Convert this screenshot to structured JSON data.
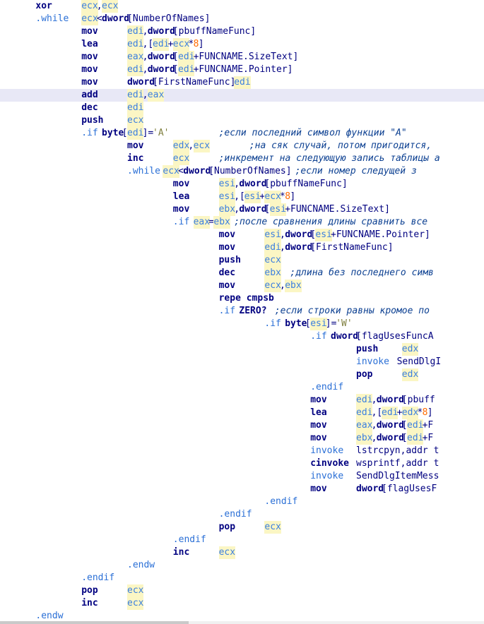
{
  "code_lines": [
    {
      "tokens": [
        {
          "t": "xor",
          "k": "ins",
          "c": 7
        },
        {
          "t": "ecx",
          "k": "reg",
          "c": 16
        },
        {
          "t": ",",
          "k": "pl",
          "c": 19
        },
        {
          "t": "ecx",
          "k": "reg",
          "c": 20
        }
      ]
    },
    {
      "tokens": [
        {
          "t": ".while",
          "k": "dir",
          "c": 7
        },
        {
          "t": "ecx",
          "k": "reg",
          "c": 16
        },
        {
          "t": "<",
          "k": "pl",
          "c": 19
        },
        {
          "t": "dword",
          "k": "ins",
          "c": 20
        },
        {
          "t": "[NumberOfNames]",
          "k": "pl",
          "c": 25
        }
      ]
    },
    {
      "tokens": [
        {
          "t": "mov",
          "k": "ins",
          "c": 16
        },
        {
          "t": "edi",
          "k": "reg",
          "c": 25
        },
        {
          "t": ",",
          "k": "pl",
          "c": 28
        },
        {
          "t": "dword",
          "k": "ins",
          "c": 29
        },
        {
          "t": "[pbuffNameFunc]",
          "k": "pl",
          "c": 34
        }
      ]
    },
    {
      "tokens": [
        {
          "t": "lea",
          "k": "ins",
          "c": 16
        },
        {
          "t": "edi",
          "k": "reg",
          "c": 25
        },
        {
          "t": ",[",
          "k": "pl",
          "c": 28
        },
        {
          "t": "edi",
          "k": "reg",
          "c": 30
        },
        {
          "t": "+",
          "k": "pl",
          "c": 33
        },
        {
          "t": "ecx",
          "k": "reg",
          "c": 34
        },
        {
          "t": "*",
          "k": "pl",
          "c": 37
        },
        {
          "t": "8",
          "k": "num",
          "c": 38
        },
        {
          "t": "]",
          "k": "pl",
          "c": 39
        }
      ]
    },
    {
      "tokens": [
        {
          "t": "mov",
          "k": "ins",
          "c": 16
        },
        {
          "t": "eax",
          "k": "reg",
          "c": 25
        },
        {
          "t": ",",
          "k": "pl",
          "c": 28
        },
        {
          "t": "dword",
          "k": "ins",
          "c": 29
        },
        {
          "t": "[",
          "k": "pl",
          "c": 34
        },
        {
          "t": "edi",
          "k": "reg",
          "c": 35
        },
        {
          "t": "+FUNCNAME.SizeText]",
          "k": "pl",
          "c": 38
        }
      ]
    },
    {
      "tokens": [
        {
          "t": "mov",
          "k": "ins",
          "c": 16
        },
        {
          "t": "edi",
          "k": "reg",
          "c": 25
        },
        {
          "t": ",",
          "k": "pl",
          "c": 28
        },
        {
          "t": "dword",
          "k": "ins",
          "c": 29
        },
        {
          "t": "[",
          "k": "pl",
          "c": 34
        },
        {
          "t": "edi",
          "k": "reg",
          "c": 35
        },
        {
          "t": "+FUNCNAME.Pointer]",
          "k": "pl",
          "c": 38
        }
      ]
    },
    {
      "tokens": [
        {
          "t": "mov",
          "k": "ins",
          "c": 16
        },
        {
          "t": "dword",
          "k": "ins",
          "c": 25
        },
        {
          "t": "[FirstNameFunc],",
          "k": "pl",
          "c": 30
        },
        {
          "t": "edi",
          "k": "reg",
          "c": 46
        }
      ]
    },
    {
      "hl": true,
      "tokens": [
        {
          "t": "add",
          "k": "ins",
          "c": 16
        },
        {
          "t": "edi",
          "k": "reg",
          "c": 25
        },
        {
          "t": ",",
          "k": "pl",
          "c": 28
        },
        {
          "t": "eax",
          "k": "reg",
          "c": 29
        }
      ]
    },
    {
      "tokens": [
        {
          "t": "dec",
          "k": "ins",
          "c": 16
        },
        {
          "t": "edi",
          "k": "reg",
          "c": 25
        }
      ]
    },
    {
      "tokens": [
        {
          "t": "push",
          "k": "ins",
          "c": 16
        },
        {
          "t": "ecx",
          "k": "reg",
          "c": 25
        }
      ]
    },
    {
      "tokens": [
        {
          "t": ".if",
          "k": "dir",
          "c": 16
        },
        {
          "t": "byte",
          "k": "ins",
          "c": 20
        },
        {
          "t": "[",
          "k": "pl",
          "c": 24
        },
        {
          "t": "edi",
          "k": "reg",
          "c": 25
        },
        {
          "t": "]=",
          "k": "pl",
          "c": 28
        },
        {
          "t": "'A'",
          "k": "str",
          "c": 30
        },
        {
          "t": ";если последний символ функции \"А\"",
          "k": "cmt",
          "c": 43
        }
      ]
    },
    {
      "tokens": [
        {
          "t": "mov",
          "k": "ins",
          "c": 25
        },
        {
          "t": "edx",
          "k": "reg",
          "c": 34
        },
        {
          "t": ",",
          "k": "pl",
          "c": 37
        },
        {
          "t": "ecx",
          "k": "reg",
          "c": 38
        },
        {
          "t": ";на сяк случай, потом пригодится,",
          "k": "cmt",
          "c": 49
        }
      ]
    },
    {
      "tokens": [
        {
          "t": "inc",
          "k": "ins",
          "c": 25
        },
        {
          "t": "ecx",
          "k": "reg",
          "c": 34
        },
        {
          "t": ";инкремент на следующую запись таблицы а",
          "k": "cmt",
          "c": 43
        }
      ]
    },
    {
      "tokens": [
        {
          "t": ".while",
          "k": "dir",
          "c": 25
        },
        {
          "t": "ecx",
          "k": "reg",
          "c": 32
        },
        {
          "t": "<",
          "k": "pl",
          "c": 35
        },
        {
          "t": "dword",
          "k": "ins",
          "c": 36
        },
        {
          "t": "[NumberOfNames]",
          "k": "pl",
          "c": 41
        },
        {
          "t": ";если номер следущей з",
          "k": "cmt",
          "c": 58
        }
      ]
    },
    {
      "tokens": [
        {
          "t": "mov",
          "k": "ins",
          "c": 34
        },
        {
          "t": "esi",
          "k": "reg",
          "c": 43
        },
        {
          "t": ",",
          "k": "pl",
          "c": 46
        },
        {
          "t": "dword",
          "k": "ins",
          "c": 47
        },
        {
          "t": "[pbuffNameFunc]",
          "k": "pl",
          "c": 52
        }
      ]
    },
    {
      "tokens": [
        {
          "t": "lea",
          "k": "ins",
          "c": 34
        },
        {
          "t": "esi",
          "k": "reg",
          "c": 43
        },
        {
          "t": ",[",
          "k": "pl",
          "c": 46
        },
        {
          "t": "esi",
          "k": "reg",
          "c": 48
        },
        {
          "t": "+",
          "k": "pl",
          "c": 51
        },
        {
          "t": "ecx",
          "k": "reg",
          "c": 52
        },
        {
          "t": "*",
          "k": "pl",
          "c": 55
        },
        {
          "t": "8",
          "k": "num",
          "c": 56
        },
        {
          "t": "]",
          "k": "pl",
          "c": 57
        }
      ]
    },
    {
      "tokens": [
        {
          "t": "mov",
          "k": "ins",
          "c": 34
        },
        {
          "t": "ebx",
          "k": "reg",
          "c": 43
        },
        {
          "t": ",",
          "k": "pl",
          "c": 46
        },
        {
          "t": "dword",
          "k": "ins",
          "c": 47
        },
        {
          "t": "[",
          "k": "pl",
          "c": 52
        },
        {
          "t": "esi",
          "k": "reg",
          "c": 53
        },
        {
          "t": "+FUNCNAME.SizeText]",
          "k": "pl",
          "c": 56
        }
      ]
    },
    {
      "tokens": [
        {
          "t": ".if",
          "k": "dir",
          "c": 34
        },
        {
          "t": "eax",
          "k": "reg",
          "c": 38
        },
        {
          "t": "=",
          "k": "pl",
          "c": 41
        },
        {
          "t": "ebx",
          "k": "reg",
          "c": 42
        },
        {
          "t": ";после сравнения длины сравнить все",
          "k": "cmt",
          "c": 46
        }
      ]
    },
    {
      "tokens": [
        {
          "t": "mov",
          "k": "ins",
          "c": 43
        },
        {
          "t": "esi",
          "k": "reg",
          "c": 52
        },
        {
          "t": ",",
          "k": "pl",
          "c": 55
        },
        {
          "t": "dword",
          "k": "ins",
          "c": 56
        },
        {
          "t": "[",
          "k": "pl",
          "c": 61
        },
        {
          "t": "esi",
          "k": "reg",
          "c": 62
        },
        {
          "t": "+FUNCNAME.Pointer]",
          "k": "pl",
          "c": 65
        }
      ]
    },
    {
      "tokens": [
        {
          "t": "mov",
          "k": "ins",
          "c": 43
        },
        {
          "t": "edi",
          "k": "reg",
          "c": 52
        },
        {
          "t": ",",
          "k": "pl",
          "c": 55
        },
        {
          "t": "dword",
          "k": "ins",
          "c": 56
        },
        {
          "t": "[FirstNameFunc]",
          "k": "pl",
          "c": 61
        }
      ]
    },
    {
      "tokens": [
        {
          "t": "push",
          "k": "ins",
          "c": 43
        },
        {
          "t": "ecx",
          "k": "reg",
          "c": 52
        }
      ]
    },
    {
      "tokens": [
        {
          "t": "dec",
          "k": "ins",
          "c": 43
        },
        {
          "t": "ebx",
          "k": "reg",
          "c": 52
        },
        {
          "t": ";длина без последнего симв",
          "k": "cmt",
          "c": 57
        }
      ]
    },
    {
      "tokens": [
        {
          "t": "mov",
          "k": "ins",
          "c": 43
        },
        {
          "t": "ecx",
          "k": "reg",
          "c": 52
        },
        {
          "t": ",",
          "k": "pl",
          "c": 55
        },
        {
          "t": "ebx",
          "k": "reg",
          "c": 56
        }
      ]
    },
    {
      "tokens": [
        {
          "t": "repe cmpsb",
          "k": "ins",
          "c": 43
        }
      ]
    },
    {
      "tokens": [
        {
          "t": ".if",
          "k": "dir",
          "c": 43
        },
        {
          "t": "ZERO?",
          "k": "ins",
          "c": 47
        },
        {
          "t": ";если строки равны кромое по",
          "k": "cmt",
          "c": 54
        }
      ]
    },
    {
      "tokens": [
        {
          "t": ".if",
          "k": "dir",
          "c": 52
        },
        {
          "t": "byte",
          "k": "ins",
          "c": 56
        },
        {
          "t": "[",
          "k": "pl",
          "c": 60
        },
        {
          "t": "esi",
          "k": "reg",
          "c": 61
        },
        {
          "t": "]=",
          "k": "pl",
          "c": 64
        },
        {
          "t": "'W'",
          "k": "str",
          "c": 66
        }
      ]
    },
    {
      "tokens": [
        {
          "t": ".if",
          "k": "dir",
          "c": 61
        },
        {
          "t": "dword",
          "k": "ins",
          "c": 65
        },
        {
          "t": "[flagUsesFuncA",
          "k": "pl",
          "c": 70
        }
      ]
    },
    {
      "tokens": [
        {
          "t": "push",
          "k": "ins",
          "c": 70
        },
        {
          "t": "edx",
          "k": "reg",
          "c": 79
        }
      ]
    },
    {
      "tokens": [
        {
          "t": "invoke",
          "k": "dir",
          "c": 70
        },
        {
          "t": "SendDlgI",
          "k": "pl",
          "c": 78
        }
      ]
    },
    {
      "tokens": [
        {
          "t": "pop",
          "k": "ins",
          "c": 70
        },
        {
          "t": "edx",
          "k": "reg",
          "c": 79
        }
      ]
    },
    {
      "tokens": [
        {
          "t": ".endif",
          "k": "dir",
          "c": 61
        }
      ]
    },
    {
      "tokens": [
        {
          "t": "mov",
          "k": "ins",
          "c": 61
        },
        {
          "t": "edi",
          "k": "reg",
          "c": 70
        },
        {
          "t": ",",
          "k": "pl",
          "c": 73
        },
        {
          "t": "dword",
          "k": "ins",
          "c": 74
        },
        {
          "t": "[pbuff",
          "k": "pl",
          "c": 79
        }
      ]
    },
    {
      "tokens": [
        {
          "t": "lea",
          "k": "ins",
          "c": 61
        },
        {
          "t": "edi",
          "k": "reg",
          "c": 70
        },
        {
          "t": ",[",
          "k": "pl",
          "c": 73
        },
        {
          "t": "edi",
          "k": "reg",
          "c": 75
        },
        {
          "t": "+",
          "k": "pl",
          "c": 78
        },
        {
          "t": "edx",
          "k": "reg",
          "c": 79
        },
        {
          "t": "*",
          "k": "pl",
          "c": 82
        },
        {
          "t": "8",
          "k": "num",
          "c": 83
        },
        {
          "t": "]",
          "k": "pl",
          "c": 84
        }
      ]
    },
    {
      "tokens": [
        {
          "t": "mov",
          "k": "ins",
          "c": 61
        },
        {
          "t": "eax",
          "k": "reg",
          "c": 70
        },
        {
          "t": ",",
          "k": "pl",
          "c": 73
        },
        {
          "t": "dword",
          "k": "ins",
          "c": 74
        },
        {
          "t": "[",
          "k": "pl",
          "c": 79
        },
        {
          "t": "edi",
          "k": "reg",
          "c": 80
        },
        {
          "t": "+F",
          "k": "pl",
          "c": 83
        }
      ]
    },
    {
      "tokens": [
        {
          "t": "mov",
          "k": "ins",
          "c": 61
        },
        {
          "t": "ebx",
          "k": "reg",
          "c": 70
        },
        {
          "t": ",",
          "k": "pl",
          "c": 73
        },
        {
          "t": "dword",
          "k": "ins",
          "c": 74
        },
        {
          "t": "[",
          "k": "pl",
          "c": 79
        },
        {
          "t": "edi",
          "k": "reg",
          "c": 80
        },
        {
          "t": "+F",
          "k": "pl",
          "c": 83
        }
      ]
    },
    {
      "tokens": [
        {
          "t": "invoke",
          "k": "dir",
          "c": 61
        },
        {
          "t": "lstrcpyn,addr t",
          "k": "pl",
          "c": 70
        }
      ]
    },
    {
      "tokens": [
        {
          "t": "cinvoke",
          "k": "ins",
          "c": 61
        },
        {
          "t": "wsprintf,addr t",
          "k": "pl",
          "c": 70
        }
      ]
    },
    {
      "tokens": [
        {
          "t": "invoke",
          "k": "dir",
          "c": 61
        },
        {
          "t": "SendDlgItemMess",
          "k": "pl",
          "c": 70
        }
      ]
    },
    {
      "tokens": [
        {
          "t": "mov",
          "k": "ins",
          "c": 61
        },
        {
          "t": "dword",
          "k": "ins",
          "c": 70
        },
        {
          "t": "[flagUsesF",
          "k": "pl",
          "c": 75
        }
      ]
    },
    {
      "tokens": [
        {
          "t": ".endif",
          "k": "dir",
          "c": 52
        }
      ]
    },
    {
      "tokens": [
        {
          "t": ".endif",
          "k": "dir",
          "c": 43
        }
      ]
    },
    {
      "tokens": [
        {
          "t": "pop",
          "k": "ins",
          "c": 43
        },
        {
          "t": "ecx",
          "k": "reg",
          "c": 52
        }
      ]
    },
    {
      "tokens": [
        {
          "t": ".endif",
          "k": "dir",
          "c": 34
        }
      ]
    },
    {
      "tokens": [
        {
          "t": "inc",
          "k": "ins",
          "c": 34
        },
        {
          "t": "ecx",
          "k": "reg",
          "c": 43
        }
      ]
    },
    {
      "tokens": [
        {
          "t": ".endw",
          "k": "dir",
          "c": 25
        }
      ]
    },
    {
      "tokens": [
        {
          "t": ".endif",
          "k": "dir",
          "c": 16
        }
      ]
    },
    {
      "tokens": [
        {
          "t": "pop",
          "k": "ins",
          "c": 16
        },
        {
          "t": "ecx",
          "k": "reg",
          "c": 25
        }
      ]
    },
    {
      "tokens": [
        {
          "t": "inc",
          "k": "ins",
          "c": 16
        },
        {
          "t": "ecx",
          "k": "reg",
          "c": 25
        }
      ]
    },
    {
      "tokens": [
        {
          "t": ".endw",
          "k": "dir",
          "c": 7
        }
      ]
    }
  ],
  "colors": {
    "keyword": "#000080",
    "directive": "#2a6fd6",
    "register": "#3b7fe0",
    "register_bg": "#fbf6c4",
    "number": "#ff6a00",
    "comment": "#0b3f91",
    "current_line": "#e8e8f6"
  },
  "scroll": {
    "horizontal_thumb_fraction": 0.39
  }
}
